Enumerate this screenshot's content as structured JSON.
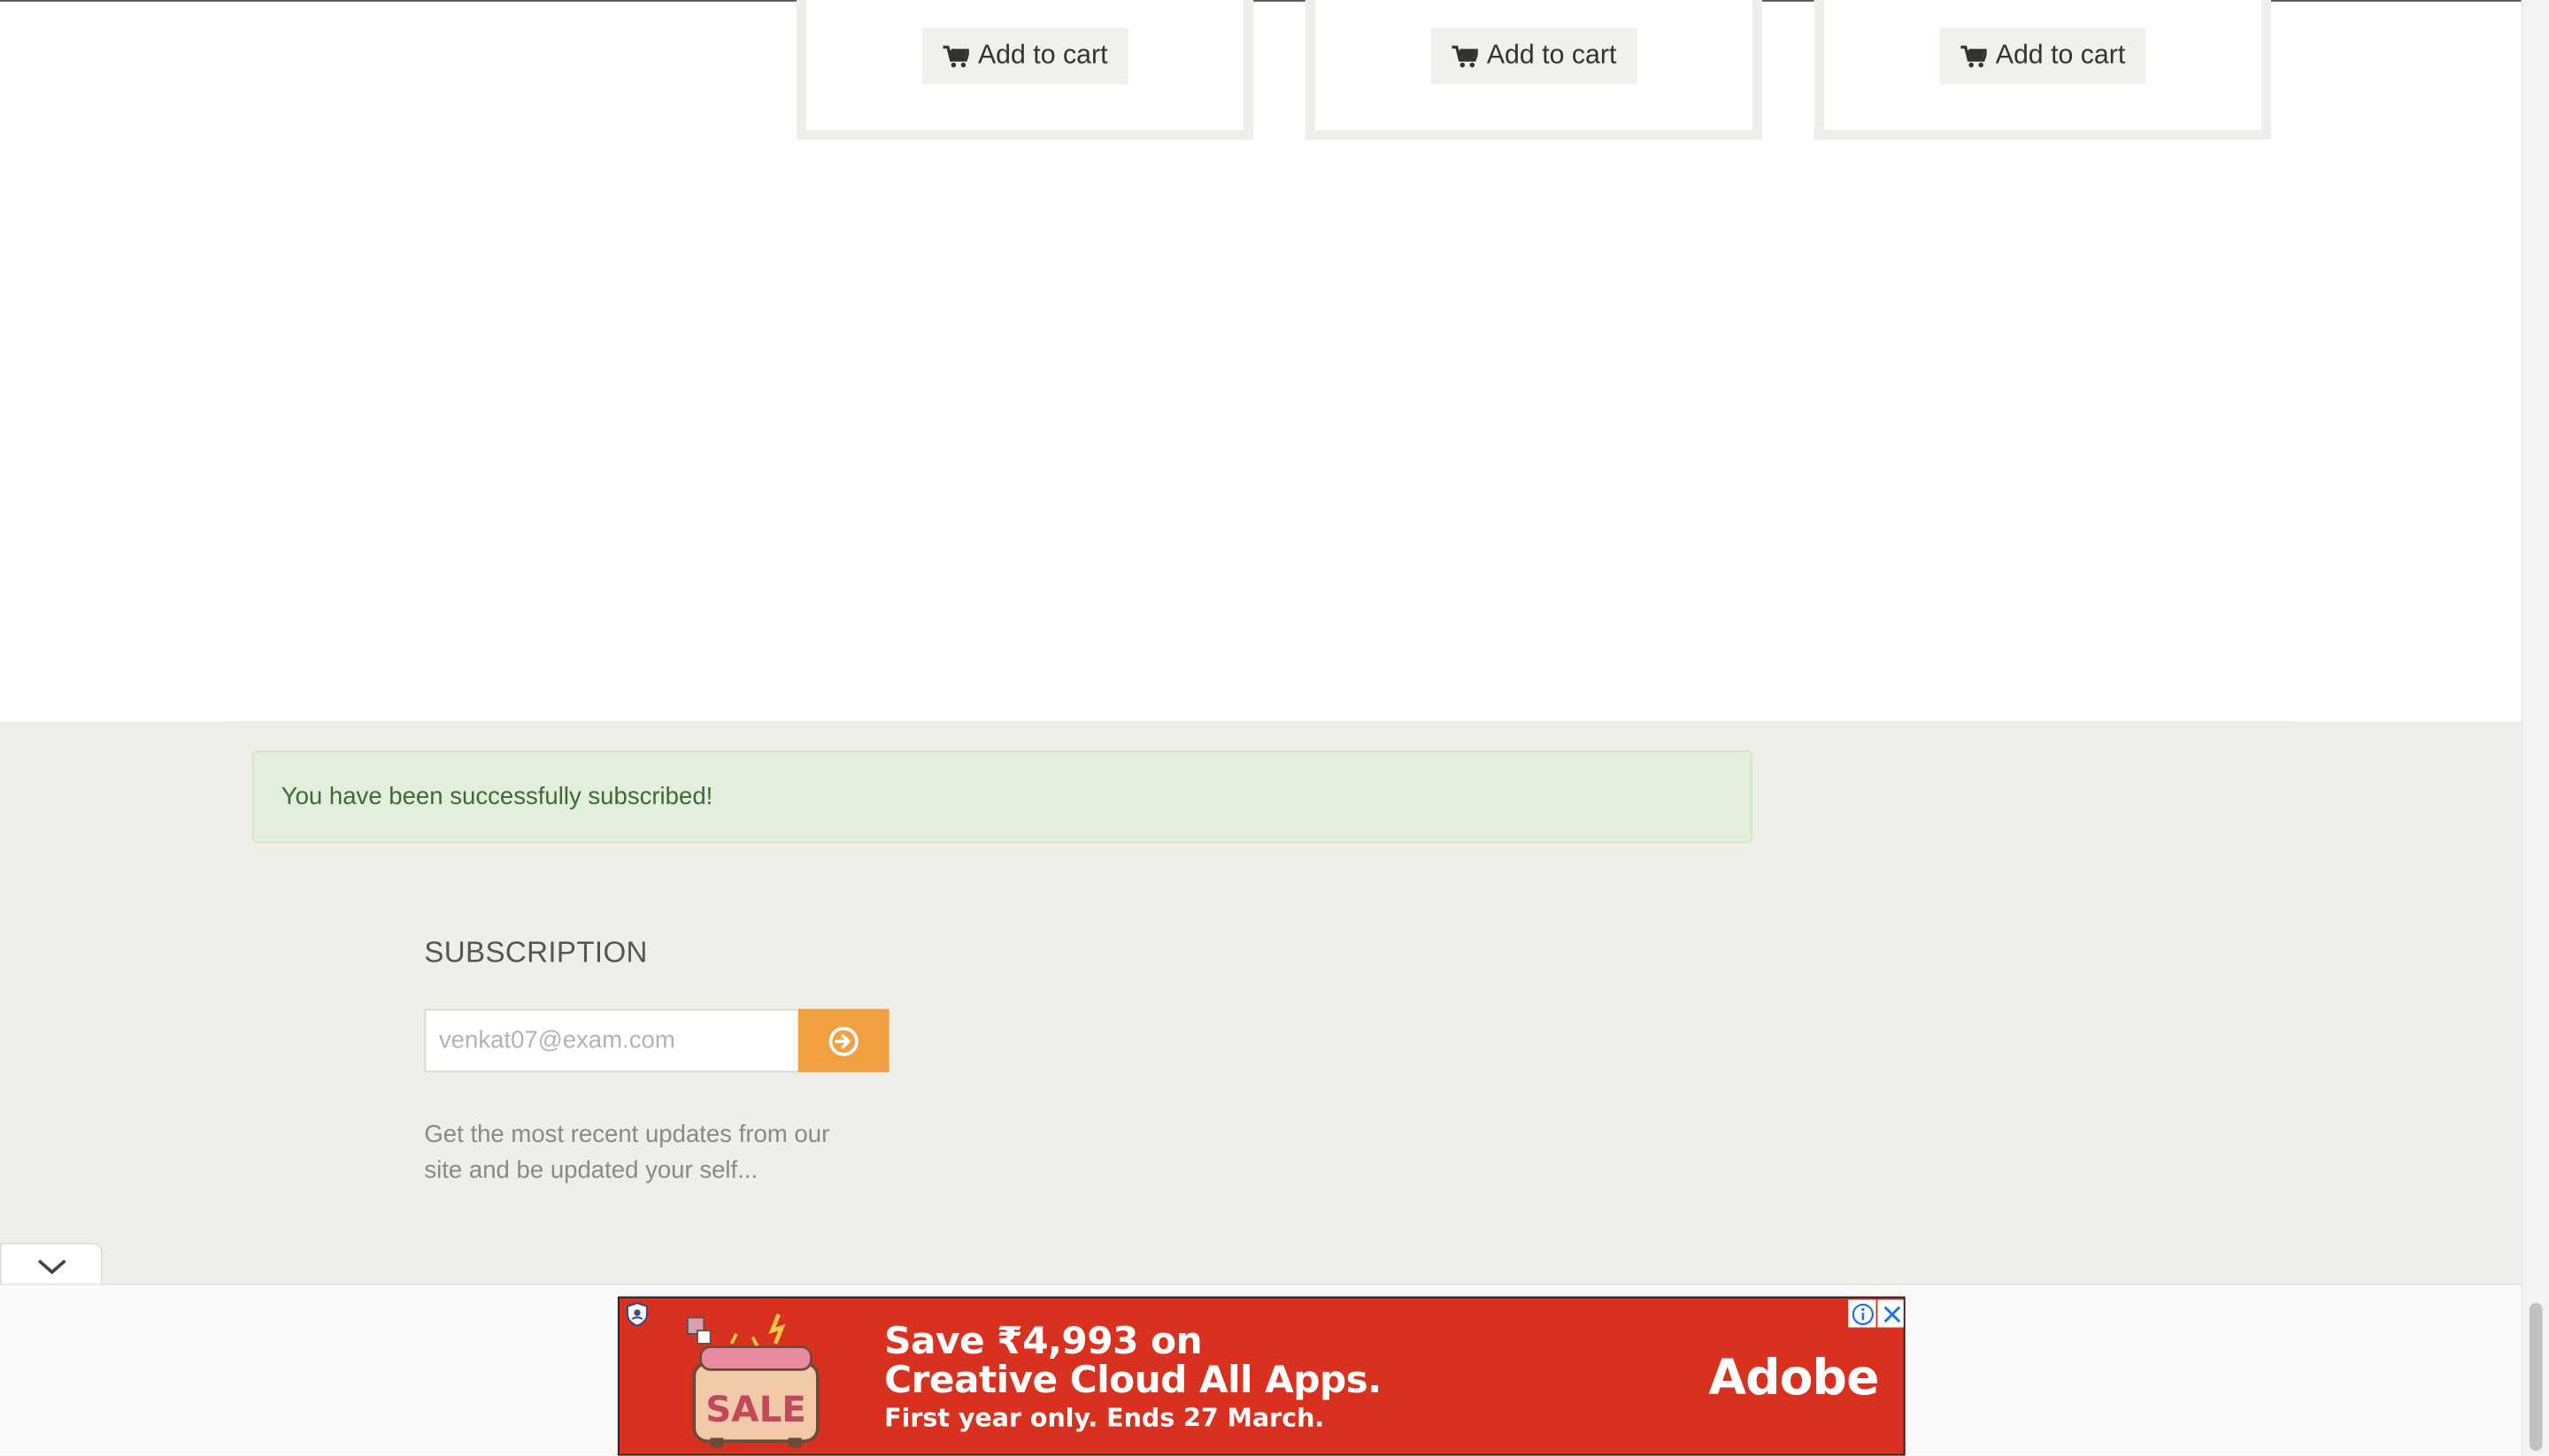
{
  "products": [
    {
      "add_to_cart": "Add to cart"
    },
    {
      "add_to_cart": "Add to cart"
    },
    {
      "add_to_cart": "Add to cart"
    }
  ],
  "alert": {
    "message": "You have been successfully subscribed!"
  },
  "subscription": {
    "title": "SUBSCRIPTION",
    "email_placeholder": "venkat07@exam.com",
    "description": "Get the most recent updates from our site and be updated your self..."
  },
  "ad": {
    "line1": "Save ₹4,993 on",
    "line2": "Creative Cloud All Apps.",
    "line3": "First year only. Ends 27 March.",
    "brand": "Adobe",
    "sale_text": "SALE",
    "background_color": "#d9311f"
  },
  "colors": {
    "accent": "#f0a040",
    "footer_bg": "#efefea",
    "success_bg": "#e3eedc",
    "success_text": "#3c6b33"
  }
}
